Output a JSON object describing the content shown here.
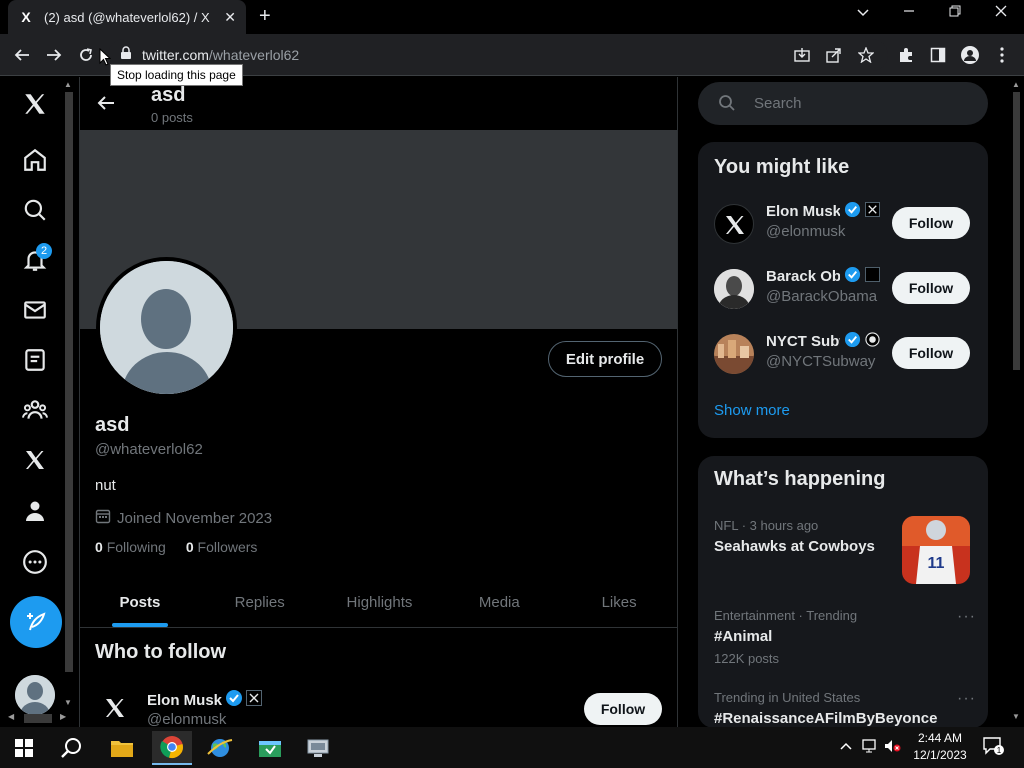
{
  "browser": {
    "tab_title": "(2) asd (@whateverlol62) / X",
    "tab_favicon": "X",
    "tab_close": "✕",
    "new_tab": "+",
    "url_host": "twitter.com",
    "url_path": "/whateverlol62",
    "tooltip": "Stop loading this page"
  },
  "nav": {
    "notification_count": "2"
  },
  "profile_header": {
    "name": "asd",
    "posts_count": "0 posts"
  },
  "profile": {
    "edit_label": "Edit profile",
    "name": "asd",
    "handle": "@whateverlol62",
    "bio": "nut",
    "joined": "Joined November 2023",
    "following_count": "0",
    "following_label": "Following",
    "followers_count": "0",
    "followers_label": "Followers"
  },
  "tabs": [
    "Posts",
    "Replies",
    "Highlights",
    "Media",
    "Likes"
  ],
  "who_to_follow": {
    "title": "Who to follow",
    "items": [
      {
        "name": "Elon Musk",
        "handle": "@elonmusk",
        "button": "Follow"
      }
    ]
  },
  "search": {
    "placeholder": "Search"
  },
  "you_might_like": {
    "title": "You might like",
    "items": [
      {
        "name": "Elon Musk",
        "handle": "@elonmusk",
        "button": "Follow"
      },
      {
        "name": "Barack Obama",
        "handle": "@BarackObama",
        "button": "Follow"
      },
      {
        "name": "NYCT Subway",
        "handle": "@NYCTSubway",
        "button": "Follow"
      }
    ],
    "show_more": "Show more"
  },
  "whats_happening": {
    "title": "What’s happening",
    "trends": [
      {
        "meta": "NFL · 3 hours ago",
        "title": "Seahawks at Cowboys",
        "sub": ""
      },
      {
        "meta": "Entertainment · Trending",
        "title": "#Animal",
        "sub": "122K posts"
      },
      {
        "meta": "Trending in United States",
        "title": "#RenaissanceAFilmByBeyonce",
        "sub": ""
      }
    ]
  },
  "taskbar": {
    "time": "2:44 AM",
    "date": "12/1/2023",
    "notif_count": "1"
  },
  "colors": {
    "accent": "#1d9bf0",
    "background": "#000000",
    "card": "#16181c"
  }
}
